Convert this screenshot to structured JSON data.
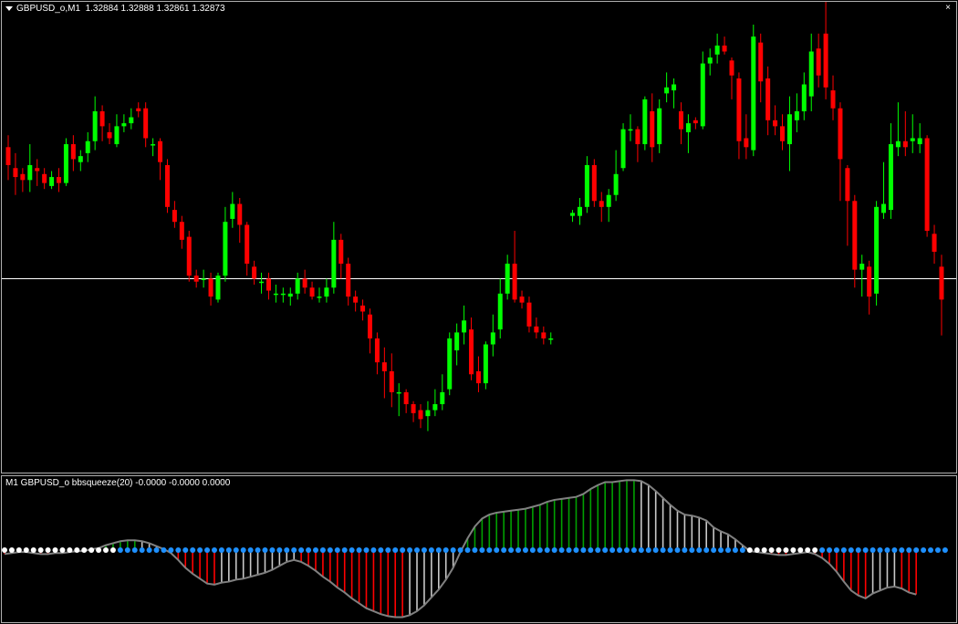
{
  "main_chart": {
    "symbol_title": "GBPUSD_o,M1",
    "ohlc_text": "1.32884 1.32888 1.32861 1.32873",
    "close_label": "×"
  },
  "indicator": {
    "title": "M1 GBPUSD_o bbsqueeze(20) -0.0000 -0.0000 0.0000"
  },
  "colors": {
    "bull": "#00ff00",
    "bear": "#ff0000",
    "hline": "#ffffff",
    "dot_blue": "#1e90ff",
    "dot_white": "#ffffff",
    "line_gray": "#808080"
  },
  "chart_data": [
    {
      "type": "candlestick",
      "title": "GBPUSD_o,M1",
      "last_ohlc": {
        "open": 1.32884,
        "high": 1.32888,
        "low": 1.32861,
        "close": 1.32873
      },
      "hline_level": 1.3288,
      "candles": [
        [
          1.32924,
          1.32918,
          1.32928,
          1.32913
        ],
        [
          1.32917,
          1.32914,
          1.32922,
          1.32908
        ],
        [
          1.32915,
          1.32913,
          1.32917,
          1.32909
        ],
        [
          1.32913,
          1.32918,
          1.32925,
          1.32909
        ],
        [
          1.32917,
          1.32916,
          1.3292,
          1.32911
        ],
        [
          1.32915,
          1.32912,
          1.32917,
          1.3291
        ],
        [
          1.32911,
          1.32914,
          1.32916,
          1.3291
        ],
        [
          1.32914,
          1.32912,
          1.32917,
          1.32909
        ],
        [
          1.32912,
          1.32925,
          1.32927,
          1.32911
        ],
        [
          1.32925,
          1.3292,
          1.32928,
          1.32916
        ],
        [
          1.32919,
          1.32921,
          1.32923,
          1.32916
        ],
        [
          1.32922,
          1.32926,
          1.32929,
          1.32919
        ],
        [
          1.32926,
          1.32936,
          1.32941,
          1.32923
        ],
        [
          1.32936,
          1.32931,
          1.32938,
          1.32926
        ],
        [
          1.32929,
          1.32927,
          1.32932,
          1.32925
        ],
        [
          1.32925,
          1.32931,
          1.32935,
          1.32924
        ],
        [
          1.32931,
          1.32932,
          1.32935,
          1.32929
        ],
        [
          1.32932,
          1.32934,
          1.32937,
          1.3293
        ],
        [
          1.32937,
          1.32936,
          1.32939,
          1.32934
        ],
        [
          1.32937,
          1.32927,
          1.32939,
          1.32924
        ],
        [
          1.32925,
          1.32925,
          1.32927,
          1.32921
        ],
        [
          1.32926,
          1.32919,
          1.32927,
          1.32913
        ],
        [
          1.32918,
          1.32904,
          1.3292,
          1.32902
        ],
        [
          1.32903,
          1.32899,
          1.32906,
          1.32897
        ],
        [
          1.32899,
          1.32893,
          1.32901,
          1.3289
        ],
        [
          1.32894,
          1.32881,
          1.32896,
          1.32879
        ],
        [
          1.32881,
          1.32879,
          1.32883,
          1.32877
        ],
        [
          1.3288,
          1.3288,
          1.32883,
          1.32877
        ],
        [
          1.3288,
          1.32874,
          1.32882,
          1.32871
        ],
        [
          1.32873,
          1.32881,
          1.32882,
          1.32872
        ],
        [
          1.32881,
          1.32899,
          1.32904,
          1.32879
        ],
        [
          1.329,
          1.32905,
          1.32909,
          1.32897
        ],
        [
          1.32905,
          1.32898,
          1.32907,
          1.32892
        ],
        [
          1.32898,
          1.32885,
          1.32899,
          1.32881
        ],
        [
          1.32884,
          1.3288,
          1.32886,
          1.32878
        ],
        [
          1.32879,
          1.32879,
          1.32882,
          1.32875
        ],
        [
          1.3288,
          1.32876,
          1.32882,
          1.32873
        ],
        [
          1.32875,
          1.32875,
          1.32878,
          1.32872
        ],
        [
          1.32875,
          1.32875,
          1.32877,
          1.32872
        ],
        [
          1.32874,
          1.32875,
          1.32877,
          1.32871
        ],
        [
          1.32875,
          1.3288,
          1.32882,
          1.32873
        ],
        [
          1.3288,
          1.32877,
          1.32883,
          1.32875
        ],
        [
          1.32877,
          1.32874,
          1.32879,
          1.32873
        ],
        [
          1.32874,
          1.32874,
          1.32877,
          1.32872
        ],
        [
          1.32874,
          1.32877,
          1.3288,
          1.32872
        ],
        [
          1.32877,
          1.32893,
          1.32899,
          1.32875
        ],
        [
          1.32893,
          1.32885,
          1.32895,
          1.3288
        ],
        [
          1.32885,
          1.32874,
          1.32887,
          1.32871
        ],
        [
          1.32874,
          1.32872,
          1.32876,
          1.32869
        ],
        [
          1.32871,
          1.32869,
          1.32873,
          1.32866
        ],
        [
          1.32868,
          1.3286,
          1.3287,
          1.32855
        ],
        [
          1.3286,
          1.32852,
          1.32862,
          1.32848
        ],
        [
          1.32852,
          1.32849,
          1.32857,
          1.3284
        ],
        [
          1.32849,
          1.32842,
          1.32855,
          1.32837
        ],
        [
          1.32842,
          1.32842,
          1.32845,
          1.32834
        ],
        [
          1.32842,
          1.32838,
          1.32843,
          1.32835
        ],
        [
          1.32838,
          1.32835,
          1.32839,
          1.32832
        ],
        [
          1.32836,
          1.32833,
          1.32838,
          1.3283
        ],
        [
          1.32834,
          1.32836,
          1.32839,
          1.32829
        ],
        [
          1.32836,
          1.32838,
          1.32843,
          1.32834
        ],
        [
          1.32838,
          1.32842,
          1.32848,
          1.32836
        ],
        [
          1.32843,
          1.3286,
          1.32862,
          1.32841
        ],
        [
          1.32856,
          1.32862,
          1.32865,
          1.32851
        ],
        [
          1.32862,
          1.32866,
          1.32871,
          1.32858
        ],
        [
          1.32863,
          1.32848,
          1.32867,
          1.32846
        ],
        [
          1.32849,
          1.32845,
          1.32854,
          1.32842
        ],
        [
          1.32845,
          1.32858,
          1.32859,
          1.32843
        ],
        [
          1.32858,
          1.32862,
          1.32868,
          1.32854
        ],
        [
          1.32863,
          1.32875,
          1.3288,
          1.3286
        ],
        [
          1.32875,
          1.32885,
          1.32888,
          1.32873
        ],
        [
          1.32885,
          1.32873,
          1.32896,
          1.32872
        ],
        [
          1.32874,
          1.32872,
          1.32876,
          1.3287
        ],
        [
          1.32872,
          1.32864,
          1.32874,
          1.32862
        ],
        [
          1.32864,
          1.32862,
          1.32867,
          1.3286
        ],
        [
          1.32862,
          1.3286,
          1.32864,
          1.32858
        ],
        [
          1.3286,
          1.3286,
          1.32862,
          1.32858
        ],
        [
          null,
          null,
          null,
          null
        ],
        [
          null,
          null,
          null,
          null
        ],
        [
          1.32901,
          1.32902,
          1.32903,
          1.32899
        ],
        [
          1.32901,
          1.32904,
          1.32907,
          1.32898
        ],
        [
          1.32904,
          1.32918,
          1.32921,
          1.32902
        ],
        [
          1.32918,
          1.32906,
          1.3292,
          1.32904
        ],
        [
          1.32906,
          1.32904,
          1.32909,
          1.32899
        ],
        [
          1.32904,
          1.32908,
          1.3291,
          1.32899
        ],
        [
          1.32908,
          1.32915,
          1.32923,
          1.32906
        ],
        [
          1.32917,
          1.3293,
          1.32932,
          1.32916
        ],
        [
          1.3293,
          1.3293,
          1.32935,
          1.32926
        ],
        [
          1.3293,
          1.32925,
          1.32931,
          1.32919
        ],
        [
          1.32925,
          1.3294,
          1.32941,
          1.32923
        ],
        [
          1.32936,
          1.32924,
          1.32942,
          1.32919
        ],
        [
          1.32925,
          1.32937,
          1.3294,
          1.32922
        ],
        [
          1.32942,
          1.32944,
          1.32949,
          1.32939
        ],
        [
          1.32943,
          1.32945,
          1.32947,
          1.32937
        ],
        [
          1.32936,
          1.3293,
          1.32939,
          1.32925
        ],
        [
          1.32929,
          1.32932,
          1.32935,
          1.32922
        ],
        [
          1.32933,
          1.32932,
          1.32934,
          1.3293
        ],
        [
          1.32931,
          1.32952,
          1.32956,
          1.3293
        ],
        [
          1.32952,
          1.32954,
          1.32957,
          1.32948
        ],
        [
          1.32955,
          1.32958,
          1.32962,
          1.32952
        ],
        [
          1.32958,
          1.32956,
          1.32961,
          1.32955
        ],
        [
          1.32953,
          1.32948,
          1.32954,
          1.3294
        ],
        [
          1.32947,
          1.32926,
          1.32949,
          1.3292
        ],
        [
          1.32927,
          1.32924,
          1.32935,
          1.3292
        ],
        [
          1.32923,
          1.32961,
          1.32965,
          1.32921
        ],
        [
          1.32959,
          1.32946,
          1.32962,
          1.32939
        ],
        [
          1.32947,
          1.32933,
          1.32951,
          1.32928
        ],
        [
          1.32933,
          1.32931,
          1.32938,
          1.32928
        ],
        [
          1.32931,
          1.32926,
          1.32935,
          1.32923
        ],
        [
          1.32925,
          1.32935,
          1.32941,
          1.32916
        ],
        [
          1.32933,
          1.32936,
          1.32942,
          1.32929
        ],
        [
          1.32936,
          1.32945,
          1.32949,
          1.32933
        ],
        [
          1.32941,
          1.32956,
          1.32962,
          1.32936
        ],
        [
          1.32957,
          1.32948,
          1.32962,
          1.32944
        ],
        [
          1.32962,
          1.32944,
          1.32976,
          1.3294
        ],
        [
          1.32943,
          1.32937,
          1.32948,
          1.32933
        ],
        [
          1.32937,
          1.3292,
          1.32939,
          1.32906
        ],
        [
          1.32917,
          1.32906,
          1.32918,
          1.32891
        ],
        [
          1.32906,
          1.32883,
          1.32908,
          1.32877
        ],
        [
          1.32883,
          1.32885,
          1.32888,
          1.32874
        ],
        [
          1.32884,
          1.32874,
          1.32886,
          1.32868
        ],
        [
          1.32875,
          1.32904,
          1.32906,
          1.32871
        ],
        [
          1.32902,
          1.32905,
          1.32919,
          1.329
        ],
        [
          1.32903,
          1.32925,
          1.32932,
          1.329
        ],
        [
          1.32924,
          1.32926,
          1.32939,
          1.32921
        ],
        [
          1.32926,
          1.32924,
          1.32936,
          1.32921
        ],
        [
          1.32926,
          1.32927,
          1.32935,
          1.32922
        ],
        [
          1.32925,
          1.32927,
          1.32932,
          1.32922
        ],
        [
          1.32927,
          1.32896,
          1.32928,
          1.32894
        ],
        [
          1.32895,
          1.32889,
          1.32898,
          1.32885
        ],
        [
          1.32884,
          1.32873,
          1.32888,
          1.32861
        ]
      ]
    },
    {
      "type": "histogram",
      "title": "bbsqueeze(20)",
      "values_shown": [
        -0.0,
        -0.0,
        0.0
      ],
      "ylim": [
        -0.00034,
        0.00034
      ],
      "line": [
        -4e-05,
        -3e-05,
        -2e-05,
        -2e-05,
        -3e-05,
        -4e-05,
        -4e-05,
        -3e-05,
        -3e-05,
        -2e-05,
        -1e-05,
        -1e-05,
        1e-05,
        2e-05,
        5e-05,
        7e-05,
        9e-05,
        0.0001,
        0.0001,
        9e-05,
        7e-05,
        4e-05,
        1e-05,
        -3e-05,
        -0.0001,
        -0.00018,
        -0.00024,
        -0.00029,
        -0.00034,
        -0.00035,
        -0.00033,
        -0.00032,
        -0.0003,
        -0.00029,
        -0.00027,
        -0.00025,
        -0.00023,
        -0.0002,
        -0.00016,
        -0.00012,
        -0.0001,
        -0.00012,
        -0.00016,
        -0.00021,
        -0.00027,
        -0.00032,
        -0.00038,
        -0.00043,
        -0.00049,
        -0.00054,
        -0.00059,
        -0.00062,
        -0.00065,
        -0.00067,
        -0.00068,
        -0.00068,
        -0.00066,
        -0.00062,
        -0.00056,
        -0.00048,
        -0.0004,
        -0.0003,
        -0.00018,
        -2e-05,
        0.00012,
        0.00024,
        0.00032,
        0.00036,
        0.00038,
        0.00039,
        0.0004,
        0.00041,
        0.00042,
        0.00044,
        0.00046,
        0.00049,
        0.00051,
        0.00052,
        0.00053,
        0.00054,
        0.00057,
        0.00062,
        0.00066,
        0.00069,
        0.00069,
        0.0007,
        0.00071,
        0.00071,
        0.0007,
        0.00066,
        0.0006,
        0.00053,
        0.00046,
        0.0004,
        0.00036,
        0.00035,
        0.00033,
        0.0003,
        0.00023,
        0.00019,
        0.00016,
        0.00011,
        5e-05,
        -1e-05,
        -2e-05,
        -3e-05,
        -4e-05,
        -5e-05,
        -5e-05,
        -4e-05,
        -3e-05,
        -2e-05,
        -4e-05,
        -8e-05,
        -0.00014,
        -0.00022,
        -0.00032,
        -0.00041,
        -0.00046,
        -0.00049,
        -0.00044,
        -0.00041,
        -0.00038,
        -0.00037,
        -0.00039,
        -0.00043,
        -0.00045
      ],
      "dots": "WWWWWWWWWWWWWWWWBBBBBBBBBBBBBBBBBBBBBBBBBBBBBBBBBBBBBBBBBBBBBBBBBBBBBBBBBBBBBBBBBBBBBBBBBBBBBBBBBBBBBBBWWWWWWWWWWBBBBBBBBBBBBBBBBBB"
    }
  ]
}
